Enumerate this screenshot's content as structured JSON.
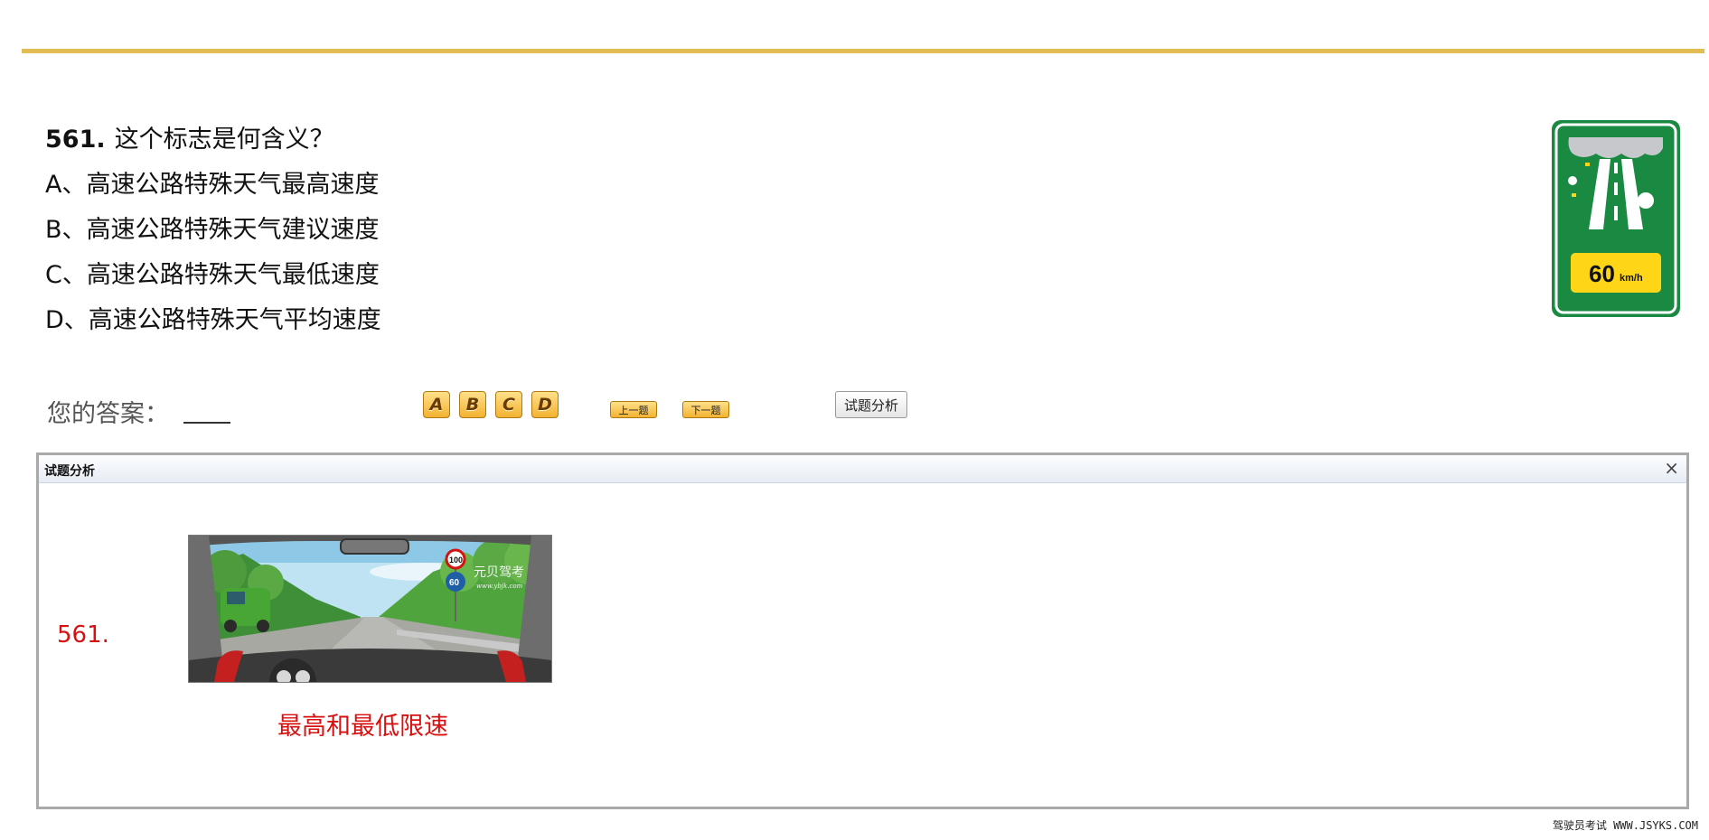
{
  "question": {
    "number": "561.",
    "text": "这个标志是何含义？",
    "options": [
      "A、高速公路特殊天气最高速度",
      "B、高速公路特殊天气建议速度",
      "C、高速公路特殊天气最低速度",
      "D、高速公路特殊天气平均速度"
    ]
  },
  "sign": {
    "speed_value": "60",
    "speed_unit": "km/h",
    "colors": {
      "board": "#1a8a43",
      "plate": "#ffd617",
      "cloud": "#c6c8cc"
    },
    "icon": "expressway-fog-speed-sign"
  },
  "answer_area": {
    "label": "您的答案：",
    "choices": [
      "A",
      "B",
      "C",
      "D"
    ],
    "prev_label": "上一题",
    "next_label": "下一题",
    "analysis_label": "试题分析"
  },
  "analysis_panel": {
    "title": "试题分析",
    "close_symbol": "×",
    "number": "561.",
    "answer_text": "最高和最低限速",
    "scene_image": {
      "speed_sign_top": "100",
      "speed_sign_bottom": "60",
      "watermark_line1": "元贝驾考",
      "watermark_line2": "www.ybjk.com"
    }
  },
  "footer": "驾驶员考试 WWW.JSYKS.COM"
}
